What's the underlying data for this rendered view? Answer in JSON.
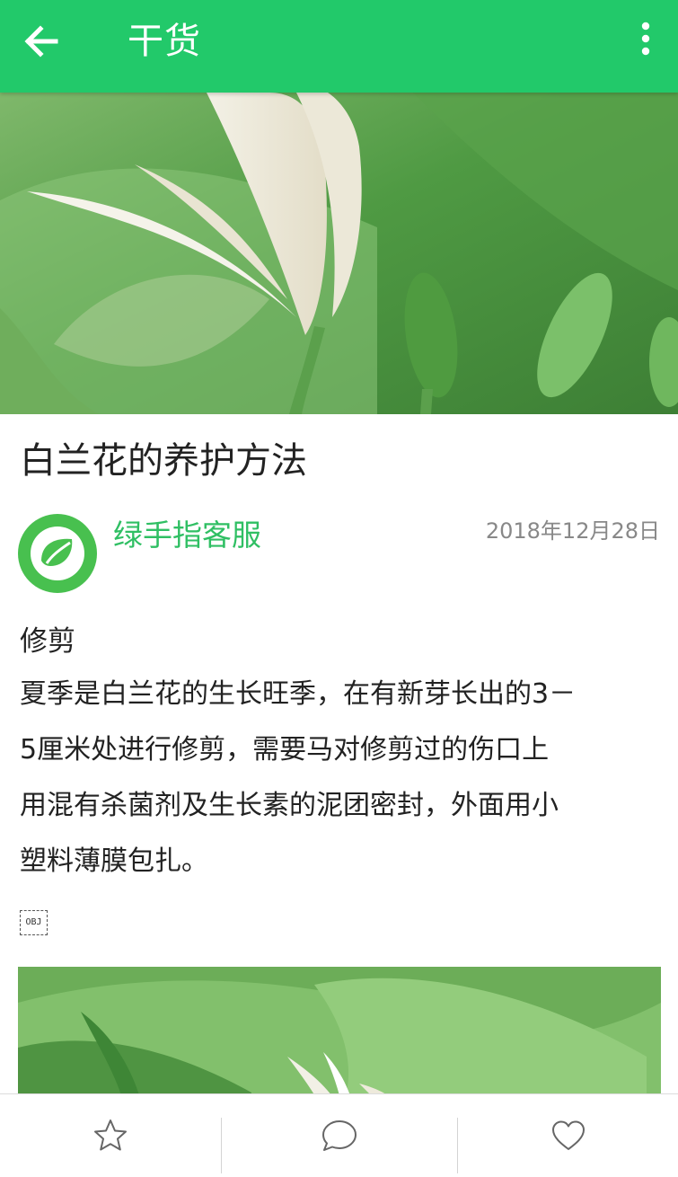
{
  "app_bar": {
    "title": "干货",
    "back_icon": "arrow-left-icon",
    "menu_icon": "more-vertical-icon",
    "background": "#22c96a"
  },
  "article": {
    "title": "白兰花的养护方法",
    "author": "绿手指客服",
    "date": "2018年12月28日",
    "section_heading": "修剪",
    "paragraph_lines": [
      "夏季是白兰花的生长旺季，在有新芽长出的3－",
      "5厘米处进行修剪，需要马对修剪过的伤口上",
      "用混有杀菌剂及生长素的泥团密封，外面用小",
      "塑料薄膜包扎。"
    ],
    "object_placeholder": "OBJ"
  },
  "bottom_bar": {
    "items": [
      {
        "icon": "star-icon",
        "action": "favorite"
      },
      {
        "icon": "comment-icon",
        "action": "comment"
      },
      {
        "icon": "heart-icon",
        "action": "like"
      }
    ]
  },
  "colors": {
    "accent": "#22c96a",
    "author_green": "#2fbf63",
    "date_gray": "#888888"
  }
}
